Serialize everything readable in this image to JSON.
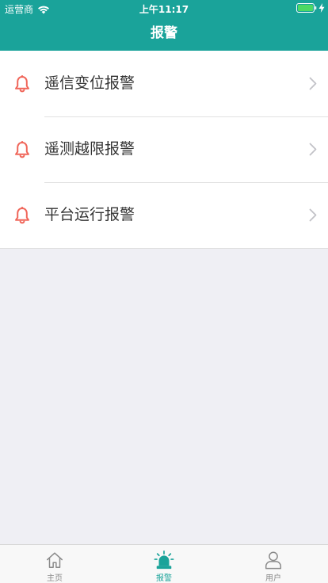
{
  "status": {
    "carrier": "运营商",
    "time": "上午11:17"
  },
  "navbar": {
    "title": "报警"
  },
  "alarms": [
    {
      "label": "遥信变位报警",
      "icon": "bell-icon"
    },
    {
      "label": "遥测越限报警",
      "icon": "bell-icon"
    },
    {
      "label": "平台运行报警",
      "icon": "bell-icon"
    }
  ],
  "tabbar": {
    "items": [
      {
        "label": "主页",
        "icon": "home-icon",
        "active": false
      },
      {
        "label": "报警",
        "icon": "siren-icon",
        "active": true
      },
      {
        "label": "用户",
        "icon": "user-icon",
        "active": false
      }
    ]
  },
  "colors": {
    "accent": "#1aa39a",
    "bell": "#f0665a",
    "background": "#efeff4"
  }
}
